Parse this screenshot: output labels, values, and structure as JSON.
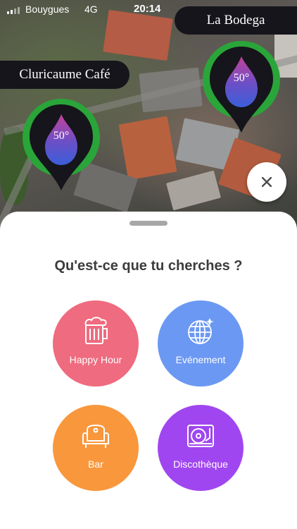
{
  "status_bar": {
    "carrier": "Bouygues",
    "network": "4G",
    "time": "20:14"
  },
  "map": {
    "places": [
      {
        "name": "La Bodega"
      },
      {
        "name": "Cluricaume Café"
      }
    ],
    "markers": [
      {
        "temperature": "50°",
        "ring_color": "#2aa539"
      },
      {
        "temperature": "50°",
        "ring_color": "#2aa539"
      }
    ],
    "close_icon": "close-icon"
  },
  "sheet": {
    "title": "Qu'est-ce que tu cherches ?",
    "categories": [
      {
        "label": "Happy Hour",
        "icon": "beer-mug-icon",
        "color": "#ef6b7f"
      },
      {
        "label": "Evénement",
        "icon": "globe-icon",
        "color": "#6b98f2"
      },
      {
        "label": "Bar",
        "icon": "sofa-icon",
        "color": "#f9973c"
      },
      {
        "label": "Discothèque",
        "icon": "turntable-icon",
        "color": "#a046f0"
      }
    ]
  }
}
